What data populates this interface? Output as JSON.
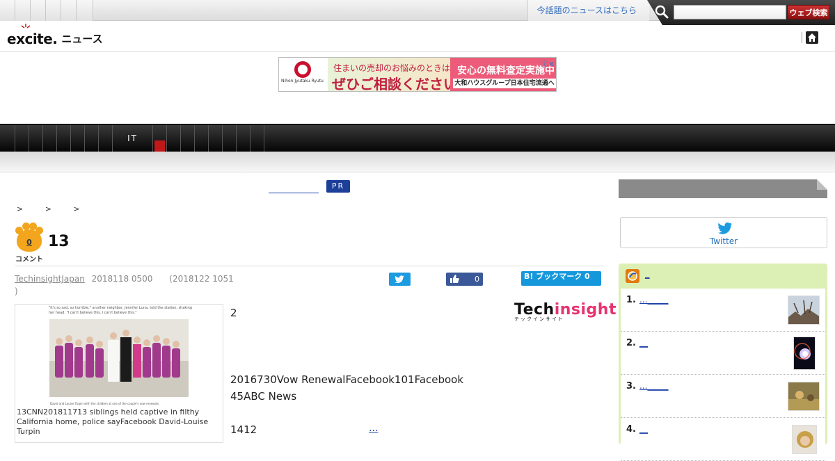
{
  "topbar": {
    "hot_news_link": "今話題のニュースはこちら",
    "search_placeholder": "",
    "search_button": "ウェブ検索"
  },
  "header": {
    "logo_brand": "excite.",
    "logo_sub": "ニュース"
  },
  "ad": {
    "company": "Nihon Jyutaku Ryutu",
    "line1": "住まいの売却のお悩みのときは",
    "line2": "ぜひご相談ください",
    "badge": "安心の無料査定実施中",
    "footer": "大和ハウスグループ日本住宅流通へ"
  },
  "nav": {
    "active_category": "IT"
  },
  "pr": {
    "badge": "PR"
  },
  "breadcrumb": "> > >",
  "article": {
    "comment_count": "0",
    "comment_label": "コメント",
    "headline": "13",
    "author": "TechinsightJapan",
    "date": "2018118 0500",
    "updated": "(2018122 1051",
    "updated_close": ")",
    "photo_caption": "13CNN201811713 siblings held captive in filthy California home, police sayFacebook David-Louise Turpin",
    "photo_quote": "\"It's so sad, so horrible,\" another neighbor, Jennifer Luna, told the station, shaking her head. \"I can't believe this. I can't believe this.\"",
    "photo_small_caption": "David and Louise Turpin with the children at one of the couple's vow renewals",
    "body_lines": [
      "2",
      "",
      "",
      "",
      "2016730Vow RenewalFacebook101Facebook",
      "45ABC News",
      "",
      "1412"
    ],
    "more": "..."
  },
  "share": {
    "facebook_count": "0",
    "hatena_label": "B! ブックマーク 0"
  },
  "source_logo": {
    "word_a": "Tech",
    "word_b": "insight",
    "sub": "テックインサイト"
  },
  "sidebar": {
    "twitter_label": "Twitter",
    "ranking_title": "_",
    "ranking": [
      {
        "num": "1.",
        "title": "..._____"
      },
      {
        "num": "2.",
        "title": "__"
      },
      {
        "num": "3.",
        "title": "..._____"
      },
      {
        "num": "4.",
        "title": "__"
      }
    ]
  },
  "colors": {
    "accent_red": "#c31e1e",
    "link_blue": "#1a3fa8",
    "twitter": "#1d9be0",
    "facebook": "#3b5998",
    "ranking_bg": "#dcefb5"
  }
}
